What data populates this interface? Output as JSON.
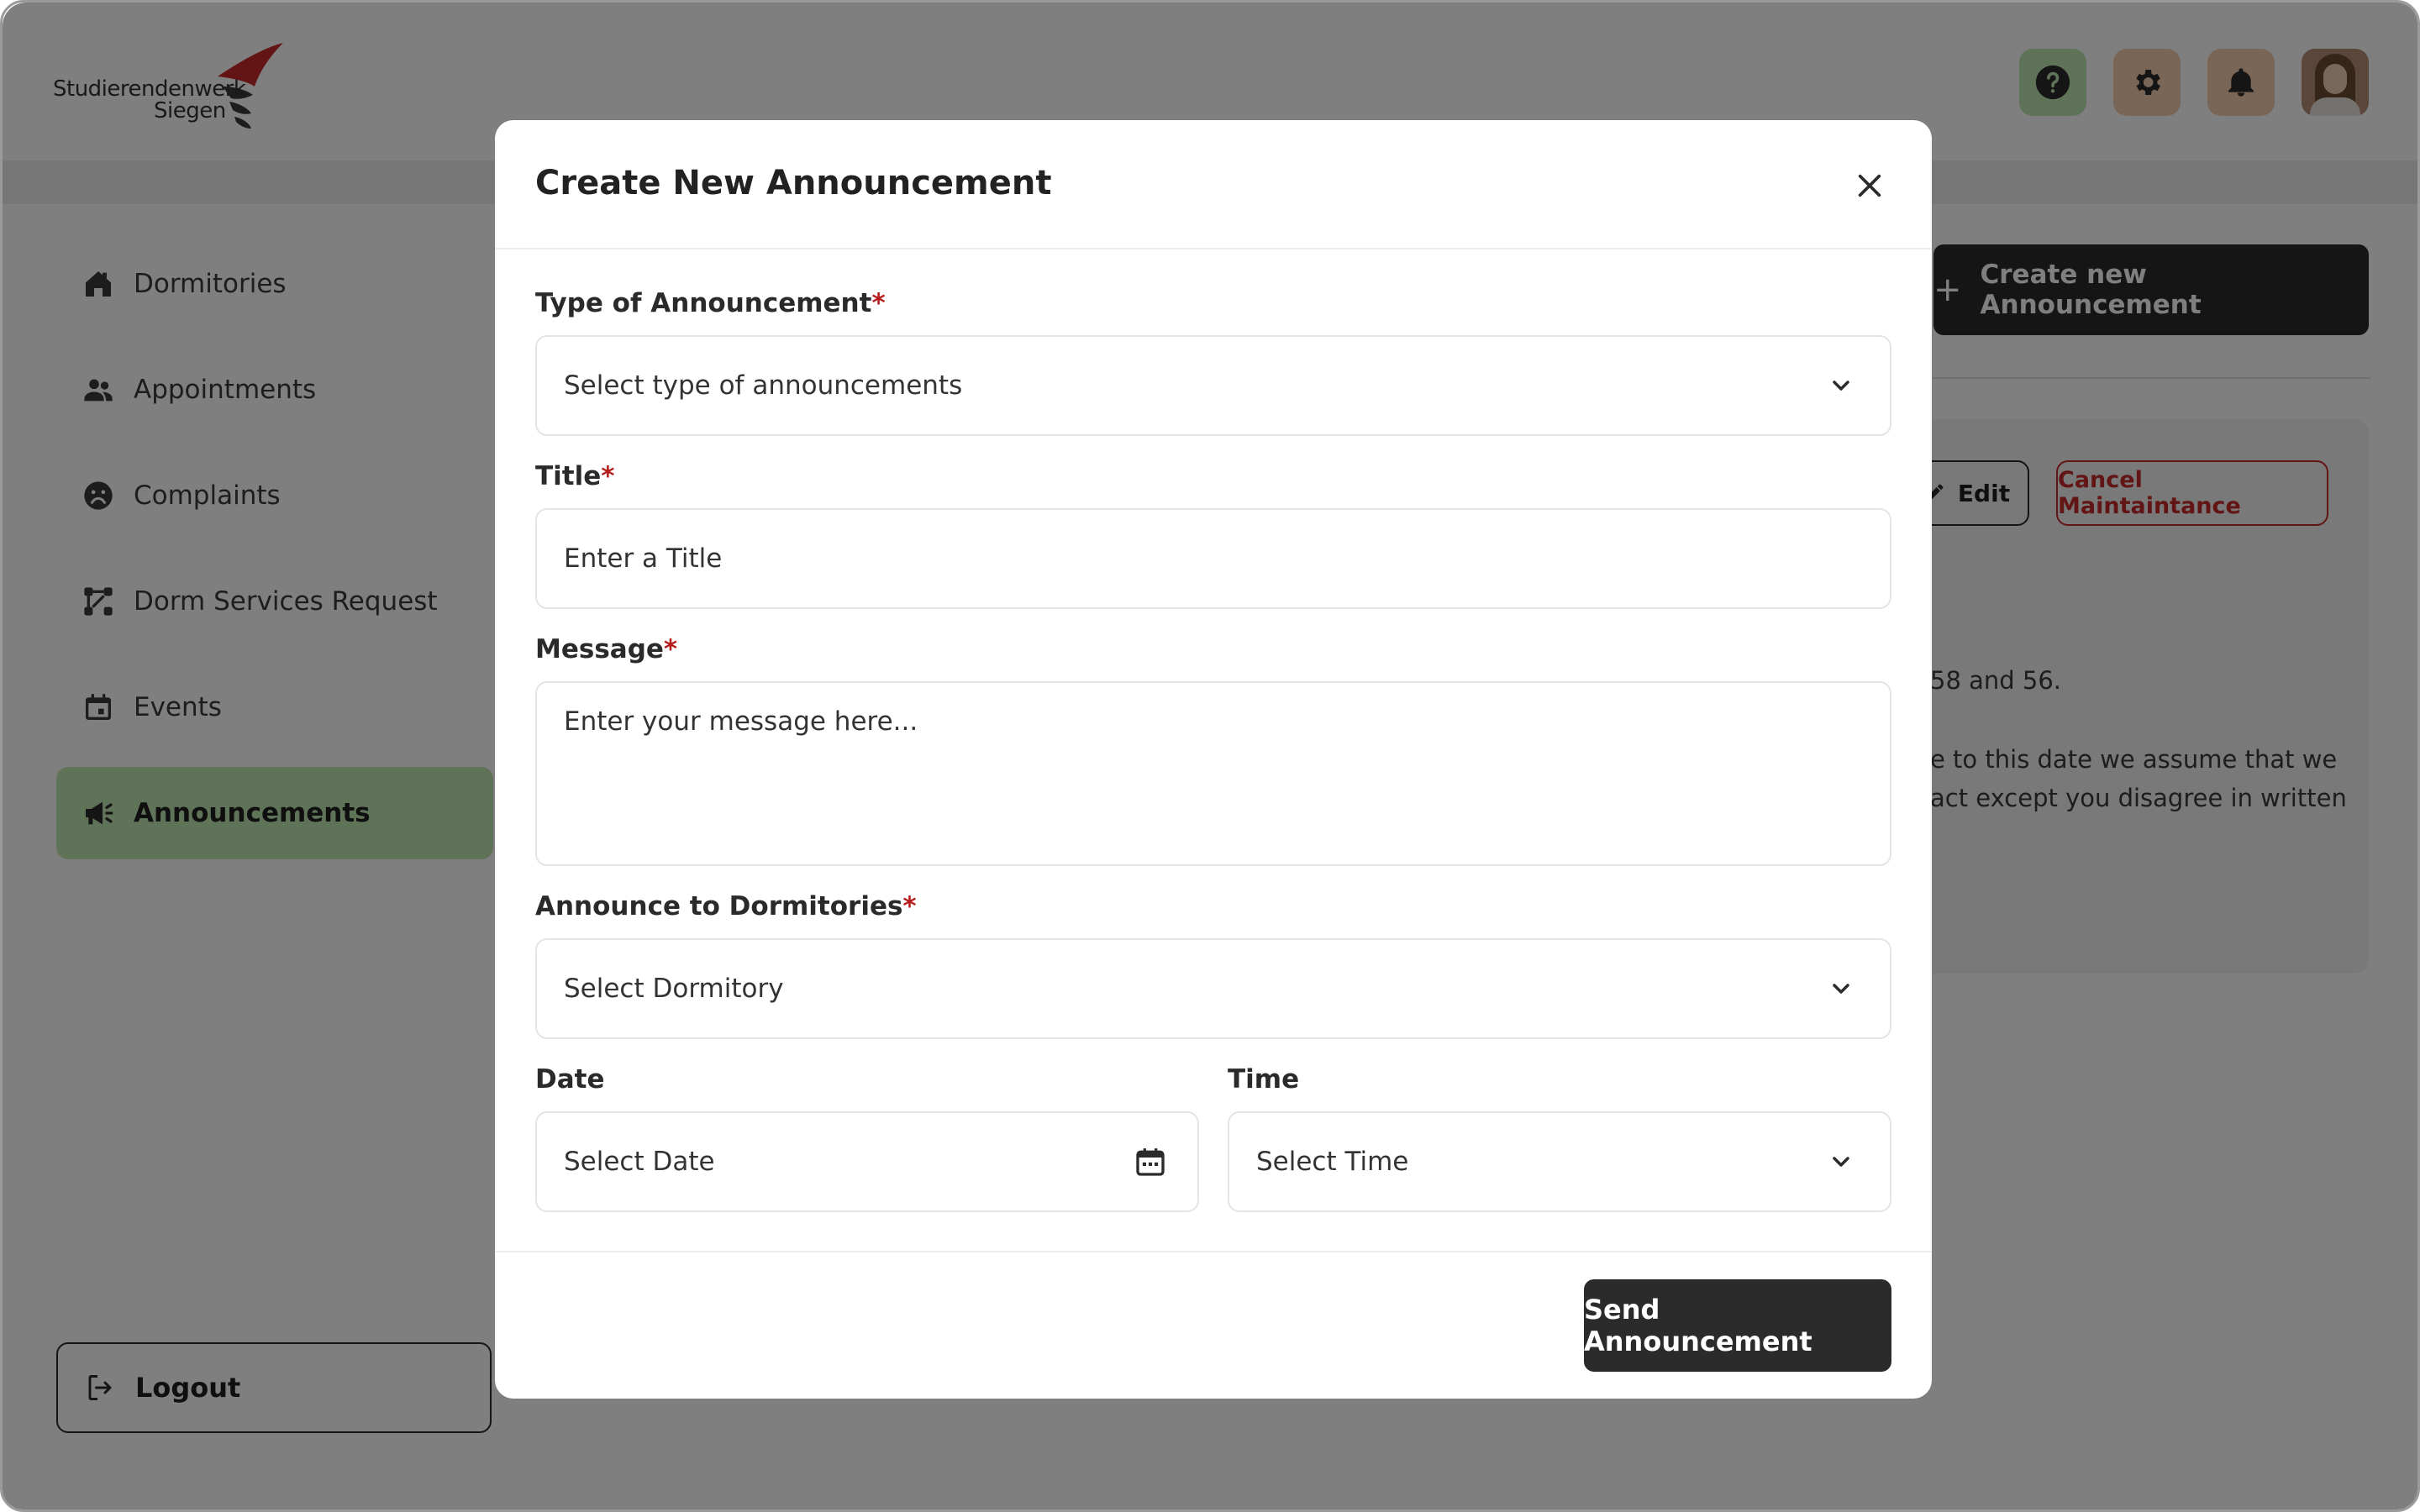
{
  "brand": {
    "name_line1": "Studierendenwerk",
    "name_line2": "Siegen",
    "accent_color": "#c62828"
  },
  "header": {
    "icons": [
      "help-icon",
      "gear-icon",
      "bell-icon",
      "avatar"
    ]
  },
  "sidebar": {
    "items": [
      {
        "label": "Dormitories",
        "icon": "home-icon",
        "active": false
      },
      {
        "label": "Appointments",
        "icon": "people-icon",
        "active": false
      },
      {
        "label": "Complaints",
        "icon": "sad-face-icon",
        "active": false
      },
      {
        "label": "Dorm Services Request",
        "icon": "flow-icon",
        "active": false
      },
      {
        "label": "Events",
        "icon": "calendar-icon",
        "active": false
      },
      {
        "label": "Announcements",
        "icon": "megaphone-icon",
        "active": true
      }
    ],
    "logout_label": "Logout",
    "active_color": "#bfe6b0"
  },
  "background": {
    "create_button_label": "Create new Announcement",
    "edit_label": "Edit",
    "cancel_label": "Cancel Maintaintance",
    "text_line1": "58 and 56.",
    "text_line2": "e to this date we assume that we",
    "text_line3": "act except you disagree in written"
  },
  "modal": {
    "title": "Create New Announcement",
    "type": {
      "label": "Type of Announcement",
      "required_mark": "*",
      "placeholder": "Select type of announcements"
    },
    "title_field": {
      "label": "Title",
      "required_mark": "*",
      "placeholder": "Enter a Title"
    },
    "message": {
      "label": "Message",
      "required_mark": "*",
      "placeholder": "Enter your message here..."
    },
    "dorms": {
      "label": "Announce to Dormitories",
      "required_mark": "*",
      "placeholder": "Select Dormitory"
    },
    "date": {
      "label": "Date",
      "placeholder": "Select Date"
    },
    "time": {
      "label": "Time",
      "placeholder": "Select Time"
    },
    "send_label": "Send Announcement"
  }
}
